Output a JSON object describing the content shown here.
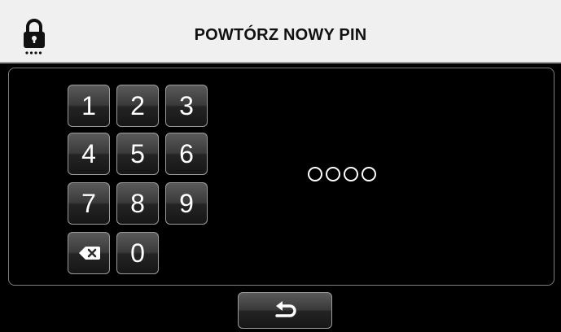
{
  "header": {
    "title": "POWTÓRZ NOWY PIN",
    "icon": "lock-icon"
  },
  "keypad": {
    "keys": [
      "1",
      "2",
      "3",
      "4",
      "5",
      "6",
      "7",
      "8",
      "9",
      "0"
    ],
    "backspace_icon": "backspace-icon"
  },
  "pin": {
    "length": 4,
    "entered": 0
  },
  "footer": {
    "back_icon": "back-arrow-icon"
  }
}
